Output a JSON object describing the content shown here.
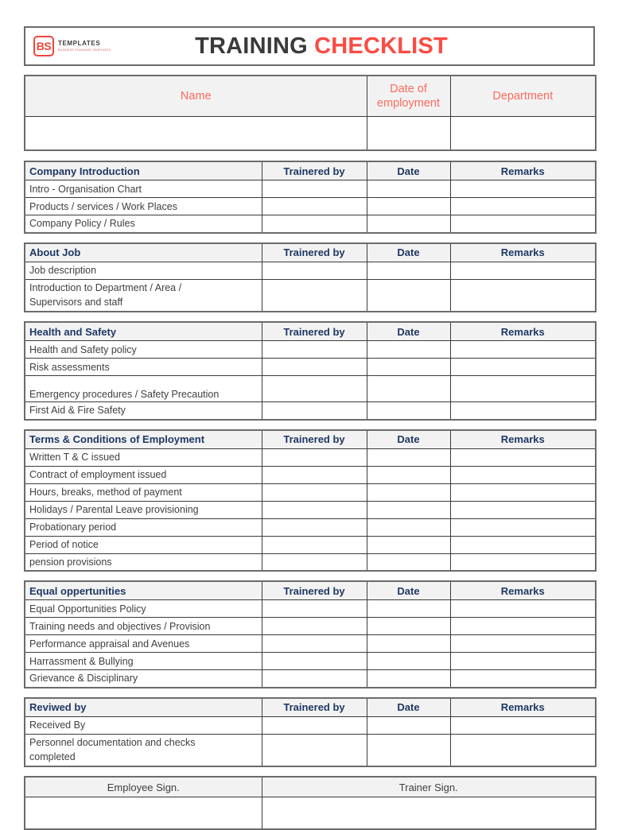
{
  "brand": {
    "logo_mark": "BS",
    "logo_word": "TEMPLATES",
    "logo_sub": "BUSINESS STANDARD TEMPLATES",
    "accent_red": "#fb4b42",
    "title_dark": "#3a3a3a",
    "header_blue": "#1f3864",
    "header_fill": "#f2f2f2"
  },
  "title": {
    "part1": "TRAINING",
    "part2": "CHECKLIST"
  },
  "info_table": {
    "headers": [
      "Name",
      "Date of\nemployment",
      "Department"
    ],
    "name_label": "Name",
    "date_label_line1": "Date of",
    "date_label_line2": "employment",
    "department_label": "Department",
    "values": [
      "",
      "",
      ""
    ]
  },
  "column_headers": {
    "trainer": "Trainered by",
    "date": "Date",
    "remarks": "Remarks"
  },
  "sections": [
    {
      "title": "Company Introduction",
      "rows": [
        {
          "label": "Intro - Organisation Chart",
          "height": "r1",
          "align": "mid",
          "trainer": "",
          "date": "",
          "remarks": ""
        },
        {
          "label": "Products / services / Work Places",
          "height": "r1",
          "align": "mid",
          "trainer": "",
          "date": "",
          "remarks": ""
        },
        {
          "label": "Company Policy / Rules",
          "height": "r1",
          "align": "mid",
          "trainer": "",
          "date": "",
          "remarks": ""
        }
      ]
    },
    {
      "title": "About Job",
      "rows": [
        {
          "label": "Job description",
          "height": "r1",
          "align": "mid",
          "trainer": "",
          "date": "",
          "remarks": ""
        },
        {
          "label": "Introduction to Department / Area /\nSupervisors and staff",
          "height": "r3",
          "align": "mid",
          "trainer": "",
          "date": "",
          "remarks": ""
        }
      ]
    },
    {
      "title": "Health and Safety",
      "rows": [
        {
          "label": "Health and Safety policy",
          "height": "r1",
          "align": "mid",
          "trainer": "",
          "date": "",
          "remarks": ""
        },
        {
          "label": "Risk assessments",
          "height": "r1",
          "align": "mid",
          "trainer": "",
          "date": "",
          "remarks": ""
        },
        {
          "label": "Emergency procedures / Safety Precaution",
          "height": "r2",
          "align": "bottom",
          "trainer": "",
          "date": "",
          "remarks": ""
        },
        {
          "label": "First Aid & Fire Safety",
          "height": "r1",
          "align": "mid",
          "trainer": "",
          "date": "",
          "remarks": ""
        }
      ]
    },
    {
      "title": "Terms & Conditions of Employment",
      "rows": [
        {
          "label": "Written T & C issued",
          "height": "r1",
          "align": "mid",
          "trainer": "",
          "date": "",
          "remarks": ""
        },
        {
          "label": "Contract of employment issued",
          "height": "r1",
          "align": "mid",
          "trainer": "",
          "date": "",
          "remarks": ""
        },
        {
          "label": "Hours, breaks, method of payment",
          "height": "r1",
          "align": "mid",
          "trainer": "",
          "date": "",
          "remarks": ""
        },
        {
          "label": "Holidays / Parental Leave provisioning",
          "height": "r1",
          "align": "mid",
          "trainer": "",
          "date": "",
          "remarks": ""
        },
        {
          "label": "Probationary period",
          "height": "r1",
          "align": "mid",
          "trainer": "",
          "date": "",
          "remarks": ""
        },
        {
          "label": "Period of notice",
          "height": "r1",
          "align": "mid",
          "trainer": "",
          "date": "",
          "remarks": ""
        },
        {
          "label": "pension provisions",
          "height": "r1",
          "align": "mid",
          "trainer": "",
          "date": "",
          "remarks": ""
        }
      ]
    },
    {
      "title": "Equal oppertunities",
      "rows": [
        {
          "label": "Equal Opportunities Policy",
          "height": "r1",
          "align": "mid",
          "trainer": "",
          "date": "",
          "remarks": ""
        },
        {
          "label": "Training needs and objectives / Provision",
          "height": "r1",
          "align": "mid",
          "trainer": "",
          "date": "",
          "remarks": ""
        },
        {
          "label": "Performance appraisal and Avenues",
          "height": "r1",
          "align": "mid",
          "trainer": "",
          "date": "",
          "remarks": ""
        },
        {
          "label": "Harrassment & Bullying",
          "height": "r1",
          "align": "mid",
          "trainer": "",
          "date": "",
          "remarks": ""
        },
        {
          "label": "Grievance & Disciplinary",
          "height": "r1",
          "align": "mid",
          "trainer": "",
          "date": "",
          "remarks": ""
        }
      ]
    },
    {
      "title": "Reviwed by",
      "rows": [
        {
          "label": "Received By",
          "height": "r1",
          "align": "mid",
          "trainer": "",
          "date": "",
          "remarks": ""
        },
        {
          "label": "Personnel documentation and checks\ncompleted",
          "height": "r3",
          "align": "mid",
          "trainer": "",
          "date": "",
          "remarks": ""
        }
      ]
    }
  ],
  "signature": {
    "employee_label": "Employee Sign.",
    "trainer_label": "Trainer Sign.",
    "employee_value": "",
    "trainer_value": ""
  }
}
